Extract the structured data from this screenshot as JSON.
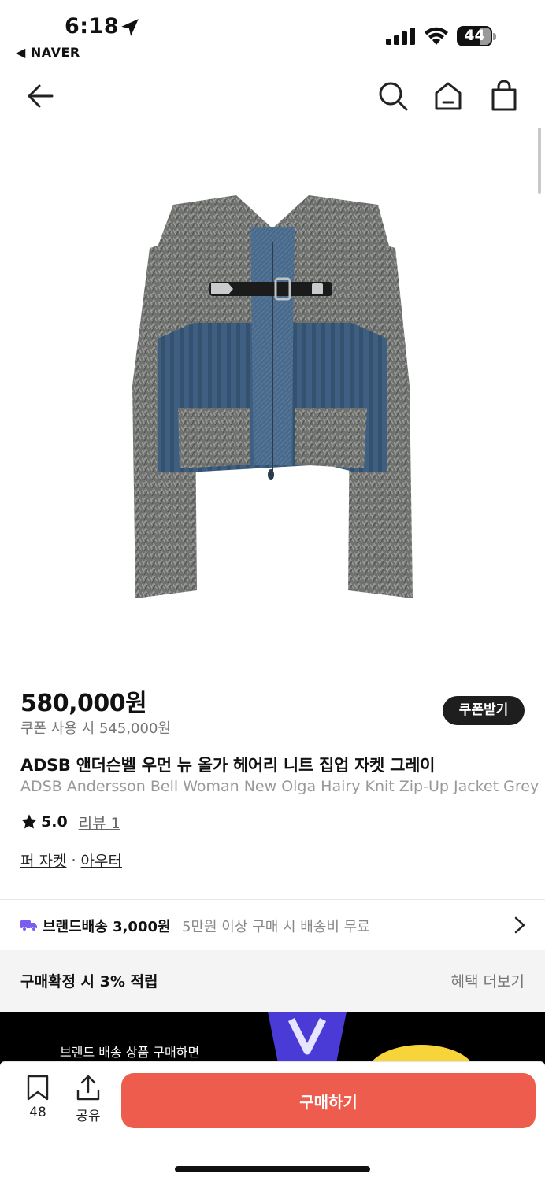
{
  "status_bar": {
    "time": "6:18",
    "back_app": "◀ NAVER",
    "battery": "44"
  },
  "nav": {
    "icons": [
      "back-arrow-icon",
      "search-icon",
      "home-icon",
      "shopping-bag-icon"
    ]
  },
  "product": {
    "image_alt": "grey faux fur and denim knit zip-up jacket",
    "price": "580,000원",
    "coupon_price": "쿠폰 사용 시 545,000원",
    "coupon_button": "쿠폰받기",
    "title_ko": "ADSB 앤더슨벨 우먼 뉴 올가 헤어리 니트 집업 자켓 그레이",
    "title_en": "ADSB Andersson Bell Woman New Olga Hairy Knit Zip-Up Jacket Grey",
    "rating": "5.0",
    "review_link": "리뷰 1",
    "categories": [
      "퍼 자켓",
      "아우터"
    ],
    "category_separator": "·"
  },
  "delivery": {
    "fee": "브랜드배송 3,000원",
    "free_note": "5만원 이상 구매 시 배송비 무료"
  },
  "points": {
    "label": "구매확정 시 3% 적립",
    "more": "혜택 더보기"
  },
  "banner": {
    "text": "브랜드 배송 상품 구매하면"
  },
  "bottom_bar": {
    "bookmark_count": "48",
    "share_label": "공유",
    "buy_label": "구매하기"
  },
  "colors": {
    "buy_button": "#ee5c4d",
    "coupon_button": "#1e1e1e",
    "delivery_truck": "#7b5cf0",
    "points_bg": "#f4f4f4"
  }
}
